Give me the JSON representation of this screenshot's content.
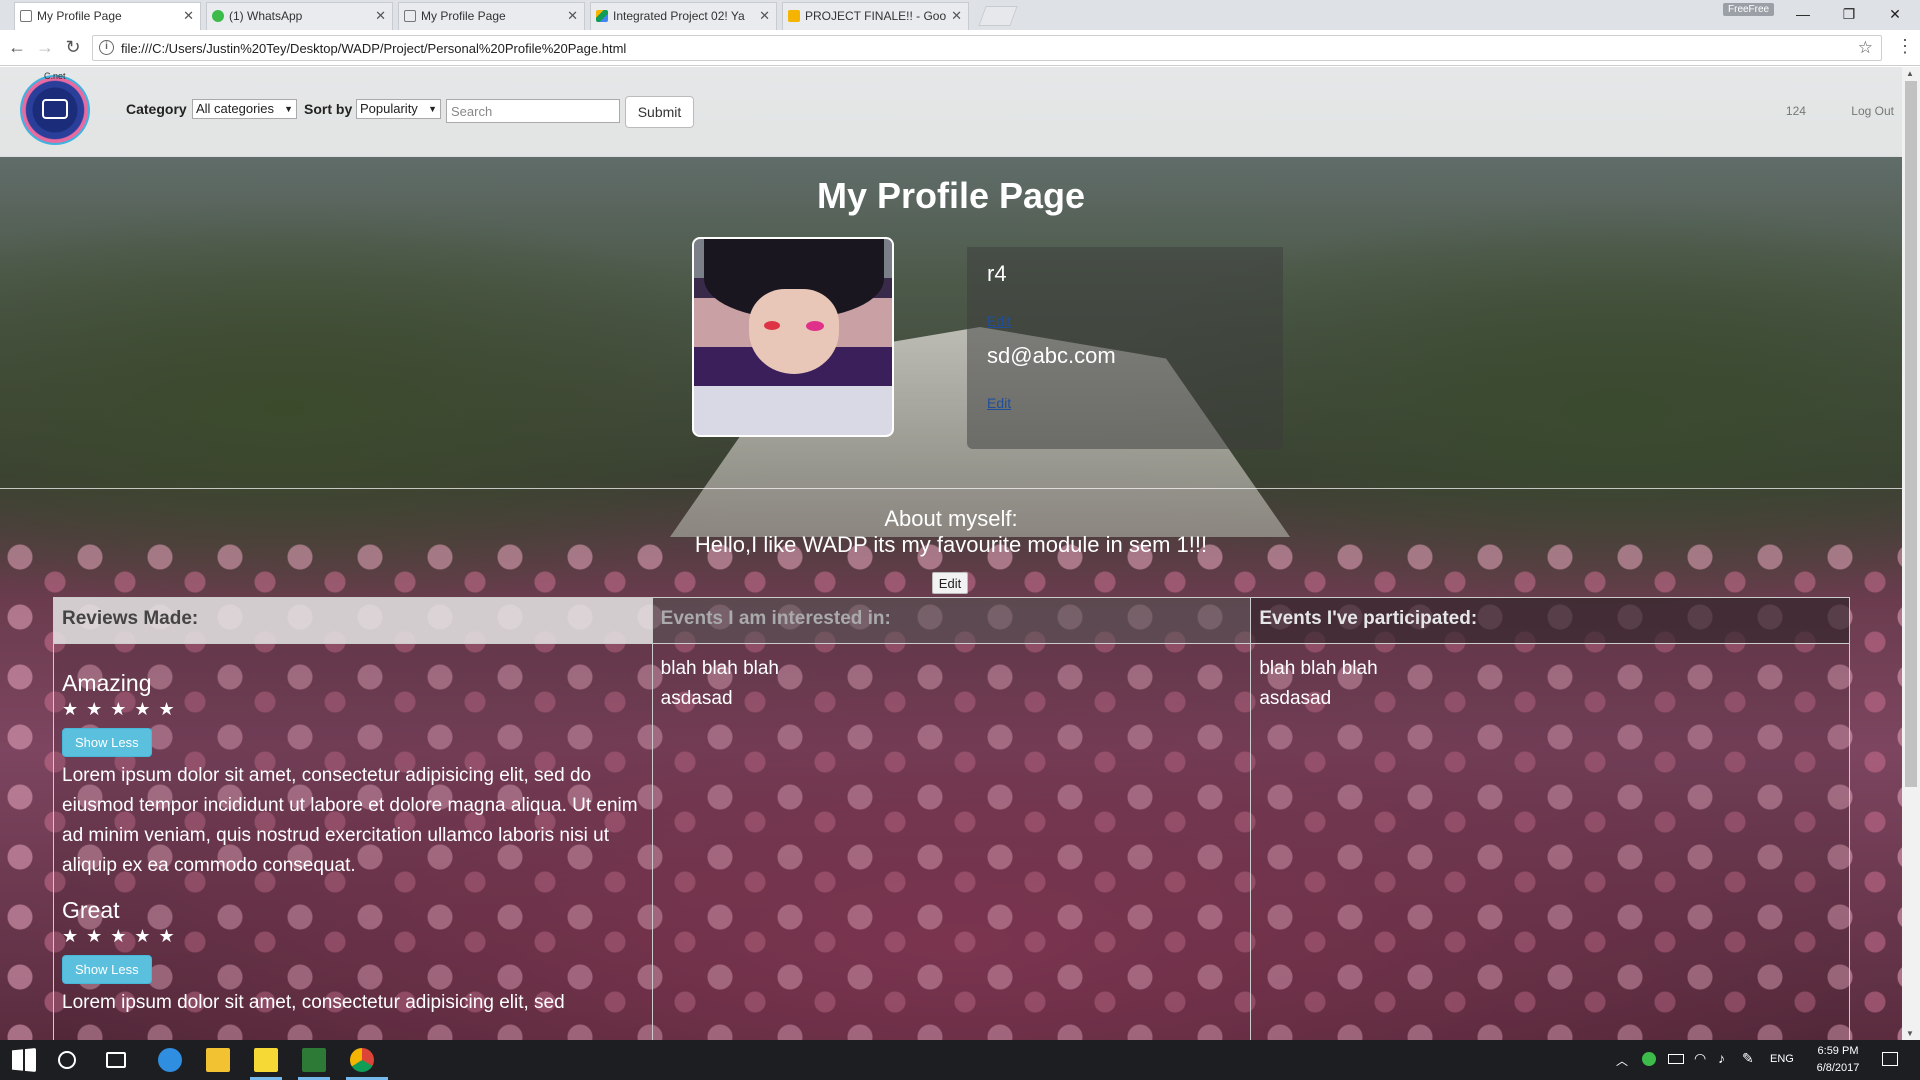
{
  "browser": {
    "tabs": [
      {
        "title": "My Profile Page",
        "active": true,
        "icon": "page-icon"
      },
      {
        "title": "(1) WhatsApp",
        "active": false,
        "icon": "whatsapp-icon"
      },
      {
        "title": "My Profile Page",
        "active": false,
        "icon": "page-icon"
      },
      {
        "title": "Integrated Project 02! Ya",
        "active": false,
        "icon": "google-drive-icon"
      },
      {
        "title": "PROJECT FINALE!! - Goo",
        "active": false,
        "icon": "google-slides-icon"
      }
    ],
    "badge": "FreeFree",
    "url": "file:///C:/Users/Justin%20Tey/Desktop/WADP/Project/Personal%20Profile%20Page.html"
  },
  "navbar": {
    "logo_text": "C.net",
    "category_label": "Category",
    "category_value": "All categories",
    "sortby_label": "Sort by",
    "sortby_value": "Popularity",
    "search_placeholder": "Search",
    "submit_label": "Submit",
    "right_links": [
      "124",
      "Log Out"
    ]
  },
  "profile": {
    "page_title": "My Profile Page",
    "username": "r4",
    "email": "sd@abc.com",
    "edit_label": "Edit"
  },
  "about": {
    "title": "About myself:",
    "text": "Hello,I like WADP its my favourite module in sem 1!!!",
    "edit_label": "Edit"
  },
  "columns": {
    "reviews_header": "Reviews Made:",
    "interested_header": "Events I am interested in:",
    "participated_header": "Events I've participated:",
    "reviews": [
      {
        "title": "Amazing",
        "stars": "★★★★★",
        "button": "Show Less",
        "text": "Lorem ipsum dolor sit amet, consectetur adipisicing elit, sed do eiusmod tempor incididunt ut labore et dolore magna aliqua. Ut enim ad minim veniam, quis nostrud exercitation ullamco laboris nisi ut aliquip ex ea commodo consequat."
      },
      {
        "title": "Great",
        "stars": "★★★★★",
        "button": "Show Less",
        "text": "Lorem ipsum dolor sit amet, consectetur adipisicing elit, sed"
      }
    ],
    "interested": [
      "blah blah blah",
      "asdasad"
    ],
    "participated": [
      "blah blah blah",
      "asdasad"
    ]
  },
  "taskbar": {
    "language": "ENG",
    "time": "6:59 PM",
    "date": "6/8/2017"
  }
}
